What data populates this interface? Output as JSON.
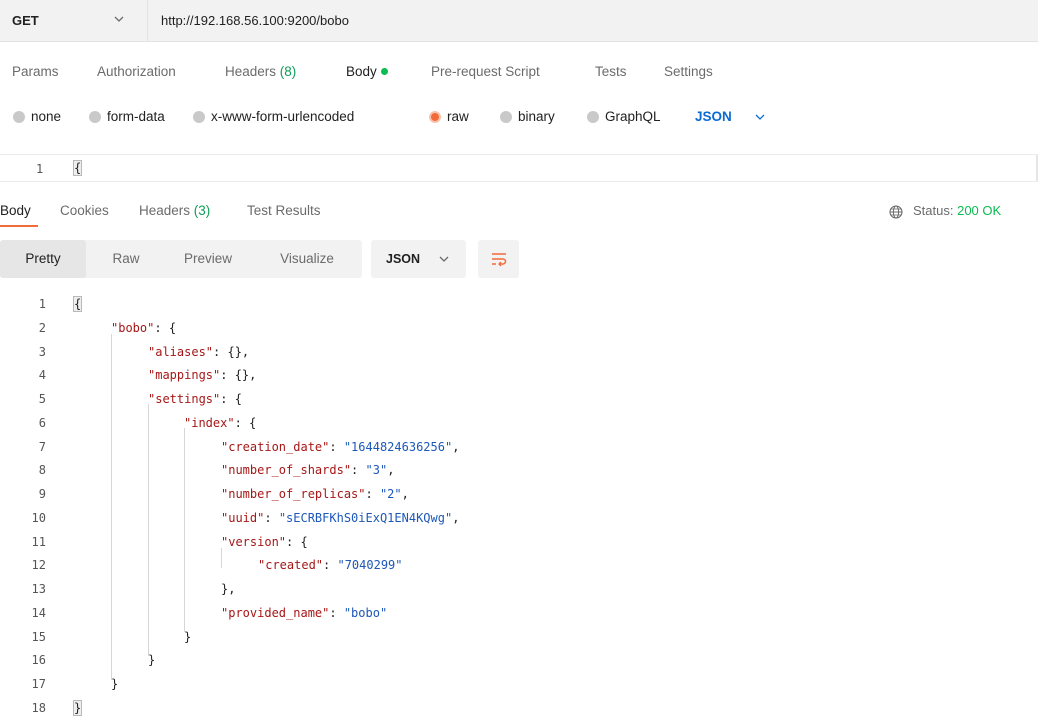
{
  "request": {
    "method": "GET",
    "url": "http://192.168.56.100:9200/bobo",
    "tabs": [
      {
        "label": "Params"
      },
      {
        "label": "Authorization"
      },
      {
        "label": "Headers",
        "count": "(8)"
      },
      {
        "label": "Body"
      },
      {
        "label": "Pre-request Script"
      },
      {
        "label": "Tests"
      },
      {
        "label": "Settings"
      }
    ],
    "body_types": [
      "none",
      "form-data",
      "x-www-form-urlencoded",
      "raw",
      "binary",
      "GraphQL"
    ],
    "selected_body_type": "raw",
    "body_language": "JSON",
    "editor": {
      "line_number": "1",
      "code": "{"
    }
  },
  "response": {
    "tabs": [
      {
        "label": "Body"
      },
      {
        "label": "Cookies"
      },
      {
        "label": "Headers",
        "count": "(3)"
      },
      {
        "label": "Test Results"
      }
    ],
    "status_label": "Status:",
    "status_value": "200 OK",
    "view_modes": [
      "Pretty",
      "Raw",
      "Preview",
      "Visualize"
    ],
    "active_view": "Pretty",
    "language": "JSON",
    "lines": [
      {
        "n": "1",
        "text": "{"
      },
      {
        "n": "2",
        "text": "\"bobo\": {"
      },
      {
        "n": "3",
        "text": "\"aliases\": {},"
      },
      {
        "n": "4",
        "text": "\"mappings\": {},"
      },
      {
        "n": "5",
        "text": "\"settings\": {"
      },
      {
        "n": "6",
        "text": "\"index\": {"
      },
      {
        "n": "7",
        "text": "\"creation_date\": \"1644824636256\","
      },
      {
        "n": "8",
        "text": "\"number_of_shards\": \"3\","
      },
      {
        "n": "9",
        "text": "\"number_of_replicas\": \"2\","
      },
      {
        "n": "10",
        "text": "\"uuid\": \"sECRBFKhS0iExQ1EN4KQwg\","
      },
      {
        "n": "11",
        "text": "\"version\": {"
      },
      {
        "n": "12",
        "text": "\"created\": \"7040299\""
      },
      {
        "n": "13",
        "text": "},"
      },
      {
        "n": "14",
        "text": "\"provided_name\": \"bobo\""
      },
      {
        "n": "15",
        "text": "}"
      },
      {
        "n": "16",
        "text": "}"
      },
      {
        "n": "17",
        "text": "}"
      },
      {
        "n": "18",
        "text": "}"
      }
    ]
  },
  "colors": {
    "accent": "#f26b3a",
    "status_ok": "#0cbb52",
    "json_key": "#a61717",
    "json_string": "#1d58b9",
    "link_blue": "#0a6bd3"
  },
  "icons": [
    "chevron-down-icon",
    "globe-icon",
    "wrap-lines-icon"
  ]
}
